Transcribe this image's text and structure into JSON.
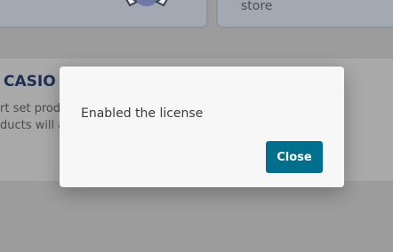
{
  "background": {
    "store_text": "store",
    "product_title": "CASIO E",
    "product_line_1": "rt set produ",
    "product_line_2": "ducts will a"
  },
  "modal": {
    "message": "Enabled the license",
    "close_label": "Close",
    "button_color": "#006f8e"
  }
}
